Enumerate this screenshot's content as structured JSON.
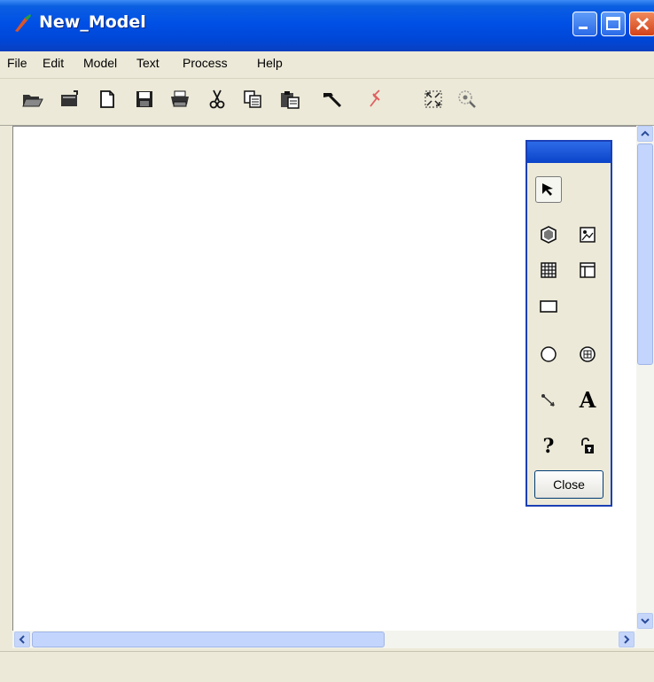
{
  "window": {
    "title": "New_Model",
    "title_bar_color": "#0050e6",
    "buttons": [
      "minimize-icon",
      "maximize-icon",
      "close-icon"
    ]
  },
  "menu": {
    "items": [
      "File",
      "Edit",
      "Model",
      "Text",
      "Process",
      "Help"
    ]
  },
  "toolbar": {
    "icons": [
      "open-folder-icon",
      "open-file-icon",
      "new-document-icon",
      "save-icon",
      "print-icon",
      "cut-icon",
      "copy-icon",
      "paste-icon",
      "hammer-icon",
      "pin-icon",
      "fit-to-window-icon",
      "zoom-icon"
    ]
  },
  "tool_palette": {
    "tools": [
      "select-arrow-icon",
      "hexagon-tool-icon",
      "image-tool-icon",
      "grid-tool-icon",
      "table-tool-icon",
      "rectangle-tool-icon",
      "circle-tool-icon",
      "grid-circle-tool-icon",
      "connector-tool-icon",
      "text-tool-icon",
      "help-tool-icon",
      "lock-tool-icon"
    ],
    "text_tool_label": "A",
    "help_tool_label": "?",
    "close_label": "Close"
  }
}
